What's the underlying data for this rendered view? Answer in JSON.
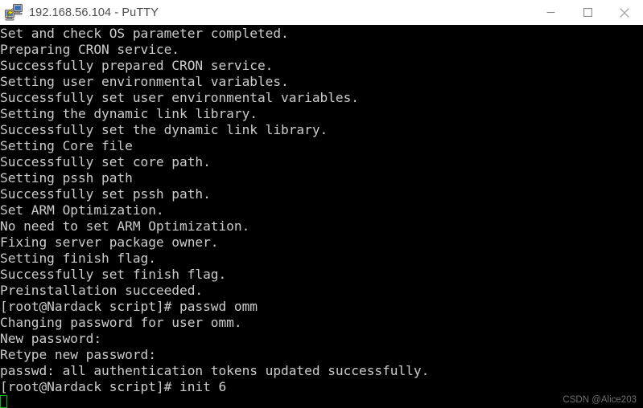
{
  "window": {
    "title": "192.168.56.104 - PuTTY",
    "icon": "putty-computers-icon",
    "controls": {
      "minimize_label": "Minimize",
      "maximize_label": "Maximize",
      "close_label": "Close"
    }
  },
  "terminal": {
    "background_color": "#000000",
    "text_color": "#cccccc",
    "cursor_color": "#00c000",
    "prompt": "[root@Nardack script]#",
    "lines": [
      "Set and check OS parameter completed.",
      "Preparing CRON service.",
      "Successfully prepared CRON service.",
      "Setting user environmental variables.",
      "Successfully set user environmental variables.",
      "Setting the dynamic link library.",
      "Successfully set the dynamic link library.",
      "Setting Core file",
      "Successfully set core path.",
      "Setting pssh path",
      "Successfully set pssh path.",
      "Set ARM Optimization.",
      "No need to set ARM Optimization.",
      "Fixing server package owner.",
      "Setting finish flag.",
      "Successfully set finish flag.",
      "Preinstallation succeeded.",
      "[root@Nardack script]# passwd omm",
      "Changing password for user omm.",
      "New password:",
      "Retype new password:",
      "passwd: all authentication tokens updated successfully.",
      "[root@Nardack script]# init 6"
    ]
  },
  "watermark": {
    "text": "CSDN @Alice203"
  }
}
